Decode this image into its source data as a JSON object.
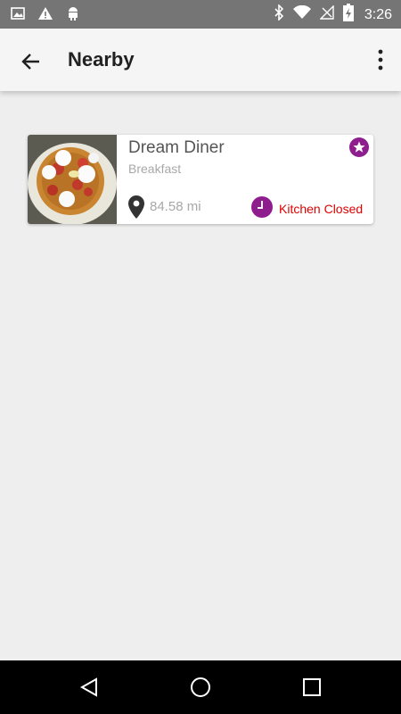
{
  "status_bar": {
    "time": "3:26",
    "icons_left": [
      "image-icon",
      "warning-icon",
      "android-icon"
    ],
    "icons_right": [
      "bluetooth-icon",
      "wifi-icon",
      "no-signal-icon",
      "battery-icon"
    ]
  },
  "app_bar": {
    "title": "Nearby",
    "back_icon": "arrow-left-icon",
    "menu_icon": "more-vert-icon"
  },
  "results": [
    {
      "name": "Dream Diner",
      "category": "Breakfast",
      "distance": "84.58 mi",
      "kitchen_status": "Kitchen Closed",
      "favorite": true,
      "image": "waffle-photo"
    }
  ],
  "colors": {
    "accent": "#8e1d8e",
    "closed": "#e00000",
    "app_bar": "#f5f5f5",
    "background": "#eeeeee"
  },
  "nav_bar": {
    "buttons": [
      "back-triangle-icon",
      "home-circle-icon",
      "recents-square-icon"
    ]
  }
}
